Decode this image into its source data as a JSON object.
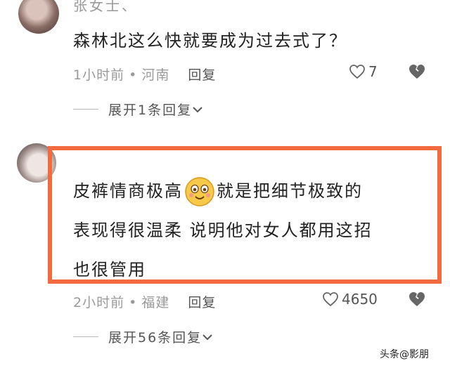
{
  "comments": [
    {
      "username": "张女士、",
      "text": "森林北这么快就要成为过去式了？",
      "time": "1小时前",
      "location": "河南",
      "reply_label": "回复",
      "likes": "7",
      "expand_label": "展开1条回复"
    },
    {
      "text_line1_before_emoji": "皮裤情商极高",
      "text_line1_after_emoji": "就是把细节极致的",
      "text_line2": "表现得很温柔 说明他对女人都用这招",
      "text_line3": "也很管用",
      "time": "2小时前",
      "location": "福建",
      "reply_label": "回复",
      "likes": "4650",
      "expand_label": "展开56条回复"
    }
  ],
  "colors": {
    "highlight": "#f36a3f",
    "meta": "#9a9a9a"
  },
  "watermark": "头条@影朋"
}
